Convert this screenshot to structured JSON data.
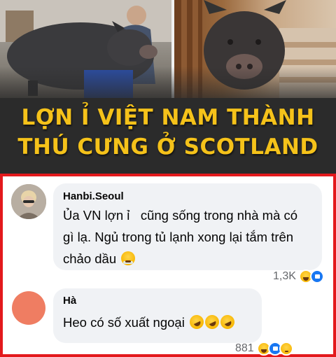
{
  "banner": {
    "headline_line1": "LỢN Ỉ VIỆT NAM THÀNH",
    "headline_line2": "THÚ CƯNG Ở SCOTLAND",
    "headline_color": "#f5c21a"
  },
  "comments": [
    {
      "author": "Hanbi.Seoul",
      "lines": [
        "Ủa VN lợn ỉ   cũng sống trong nhà mà có",
        "gì lạ. Ngủ trong tủ lạnh xong lại tắm trên",
        "chảo dầu"
      ],
      "emoji": "face-with-steam-icon",
      "reaction_count": "1,3K",
      "reactions": [
        "haha-icon",
        "like-icon"
      ]
    },
    {
      "author": "Hà",
      "text": "Heo có số xuất ngoại",
      "emoji": "rofl-icon",
      "reaction_count": "881",
      "reactions": [
        "haha-icon",
        "like-icon",
        "sad-icon"
      ]
    }
  ],
  "colors": {
    "panel_border": "#e3191c",
    "bubble_bg": "#f0f2f5",
    "like_blue": "#1877f2"
  }
}
